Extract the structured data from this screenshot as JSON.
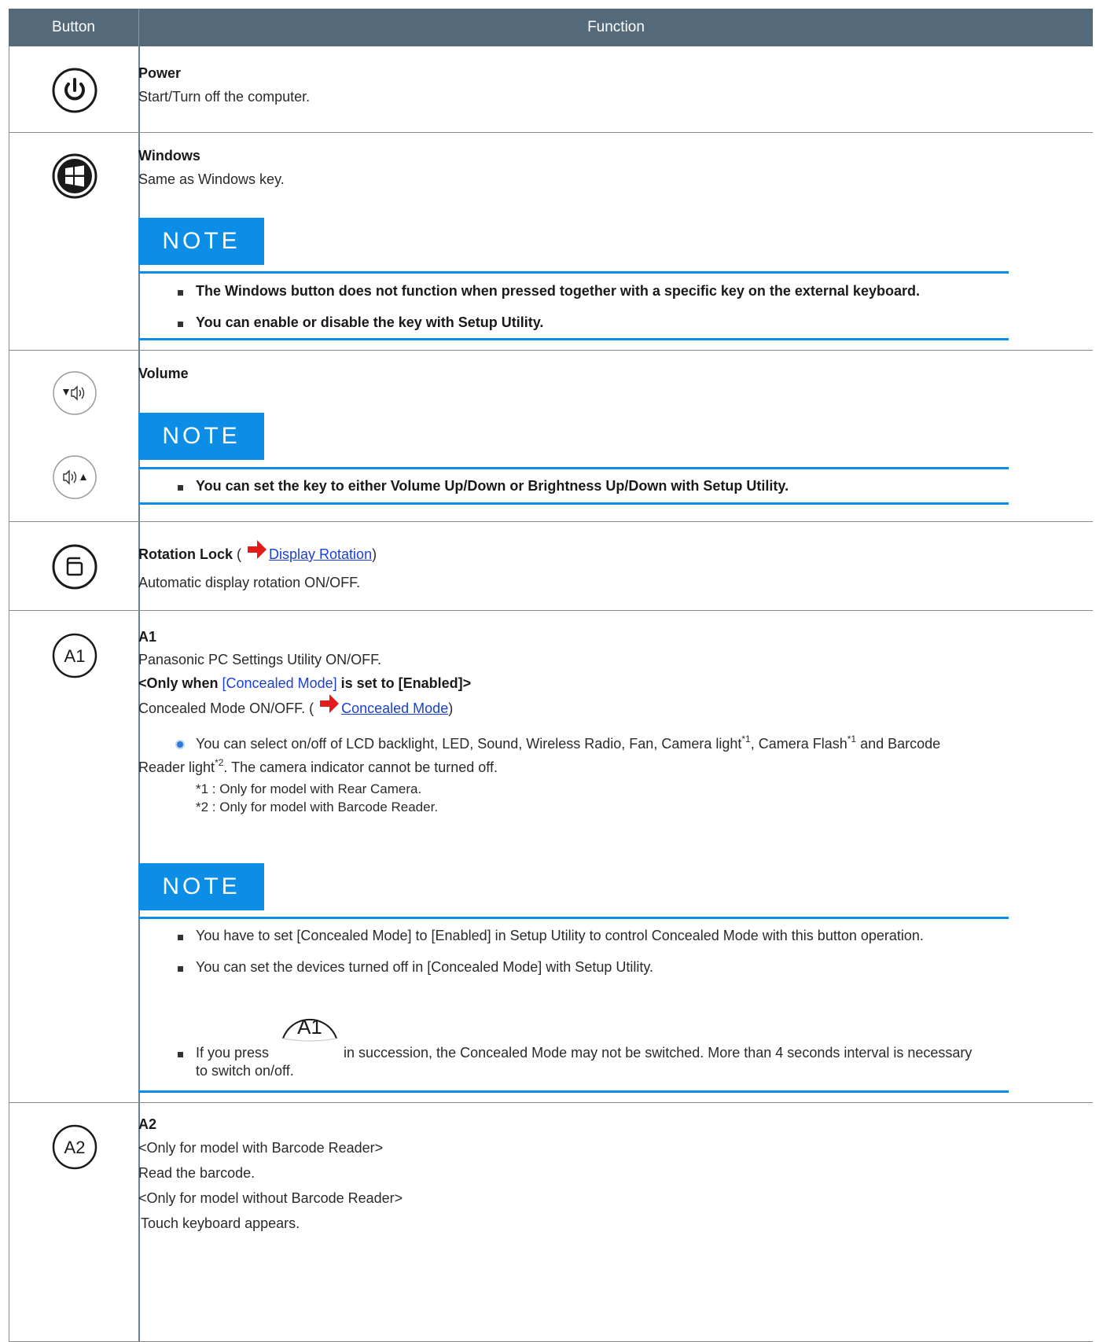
{
  "table": {
    "header": {
      "col_button": "Button",
      "col_function": "Function"
    }
  },
  "colors": {
    "header_bg": "#546a7b",
    "note_accent": "#0c8ee6",
    "link": "#1a3fd6",
    "arrow": "#e31b1b"
  },
  "rows": {
    "power": {
      "icon": "power-icon",
      "title": "Power",
      "desc": "Start/Turn off the computer."
    },
    "windows": {
      "icon": "windows-icon",
      "title": "Windows",
      "desc": "Same as Windows key.",
      "note_label": "NOTE",
      "notes": [
        "The Windows button does not function when pressed together with a specific key on the external keyboard.",
        "You can enable or disable the key with Setup Utility."
      ]
    },
    "volume": {
      "icon_down": "volume-down-icon",
      "icon_up": "volume-up-icon",
      "title": "Volume",
      "note_label": "NOTE",
      "notes": [
        "You can set the key to either Volume Up/Down or Brightness Up/Down with Setup Utility."
      ]
    },
    "rotation": {
      "icon": "rotation-lock-icon",
      "title": "Rotation Lock",
      "paren_open": " (",
      "link": "Display Rotation",
      "paren_close": ")",
      "desc": "Automatic display rotation ON/OFF."
    },
    "a1": {
      "icon": "a1-icon",
      "icon_text": "A1",
      "title": "A1",
      "desc": "Panasonic PC Settings Utility ON/OFF.",
      "cond_pre": "<Only when ",
      "cond_link": "[Concealed Mode]",
      "cond_post": " is set to [Enabled]>",
      "concealed_pre": "Concealed Mode ON/OFF. (",
      "concealed_link": "Concealed Mode",
      "concealed_post": ")",
      "bullet_line1_a": "You can select on/off of LCD backlight, LED, Sound, Wireless Radio, Fan, Camera light",
      "sup1": "*1",
      "bullet_line1_b": ", Camera Flash",
      "sup2": "*1",
      "bullet_line1_c": " and Barcode",
      "bullet_line2_a": "Reader light",
      "sup3": "*2",
      "bullet_line2_b": ". The camera indicator cannot be turned off.",
      "foot1": "*1 : Only for model with Rear Camera.",
      "foot2": "*2 : Only for model with Barcode Reader.",
      "note_label": "NOTE",
      "notes": [
        "You have to set [Concealed Mode] to [Enabled] in Setup Utility to control Concealed Mode with this button operation.",
        "You can set the devices turned off in [Concealed Mode] with Setup Utility."
      ],
      "press_pre": "If you press",
      "press_post": "in succession, the Concealed Mode may not be switched. More than 4 seconds interval is necessary",
      "press_line2": "to switch on/off."
    },
    "a2": {
      "icon": "a2-icon",
      "icon_text": "A2",
      "title": "A2",
      "line1": "<Only for model with Barcode Reader>",
      "line2": "Read the barcode.",
      "line3": "<Only for model without Barcode Reader>",
      "line4": "Touch keyboard appears."
    }
  }
}
